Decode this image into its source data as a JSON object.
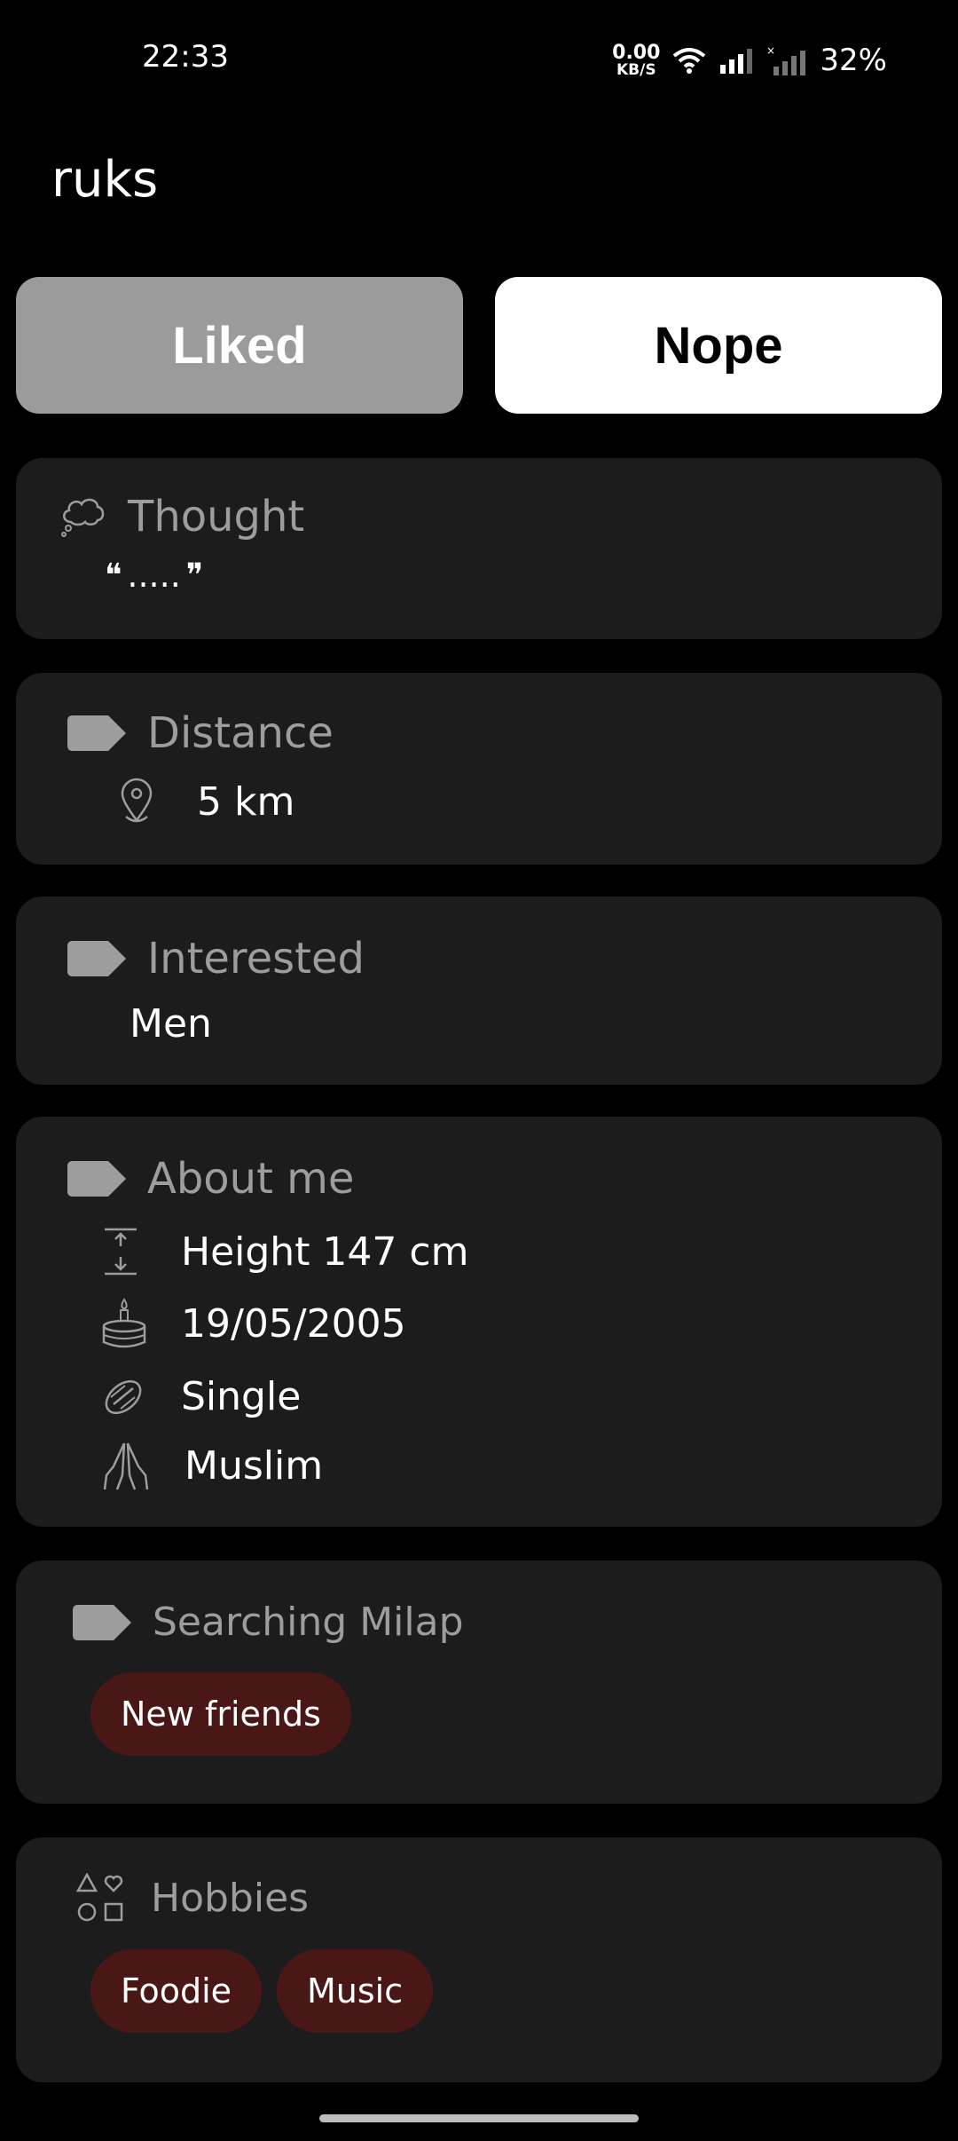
{
  "status_bar": {
    "time": "22:33",
    "net_speed_value": "0.00",
    "net_speed_unit": "KB/S",
    "battery": "32%"
  },
  "profile": {
    "name": "ruks"
  },
  "actions": {
    "liked": "Liked",
    "nope": "Nope"
  },
  "thought": {
    "title": "Thought",
    "open_quote": "❝",
    "text": ".....",
    "close_quote": "❞"
  },
  "distance": {
    "title": "Distance",
    "value": "5 km"
  },
  "interested": {
    "title": "Interested",
    "value": "Men"
  },
  "about": {
    "title": "About me",
    "height": "Height 147 cm",
    "birthday": "19/05/2005",
    "relationship": "Single",
    "religion": "Muslim"
  },
  "searching": {
    "title": "Searching Milap",
    "chips": [
      "New friends"
    ]
  },
  "hobbies": {
    "title": "Hobbies",
    "chips": [
      "Foodie",
      "Music"
    ]
  },
  "colors": {
    "background": "#000000",
    "card": "#1c1c1c",
    "chip": "#4a1717",
    "liked_button": "#9b9b9b",
    "nope_button": "#ffffff",
    "muted_text": "#9d9d9d"
  }
}
